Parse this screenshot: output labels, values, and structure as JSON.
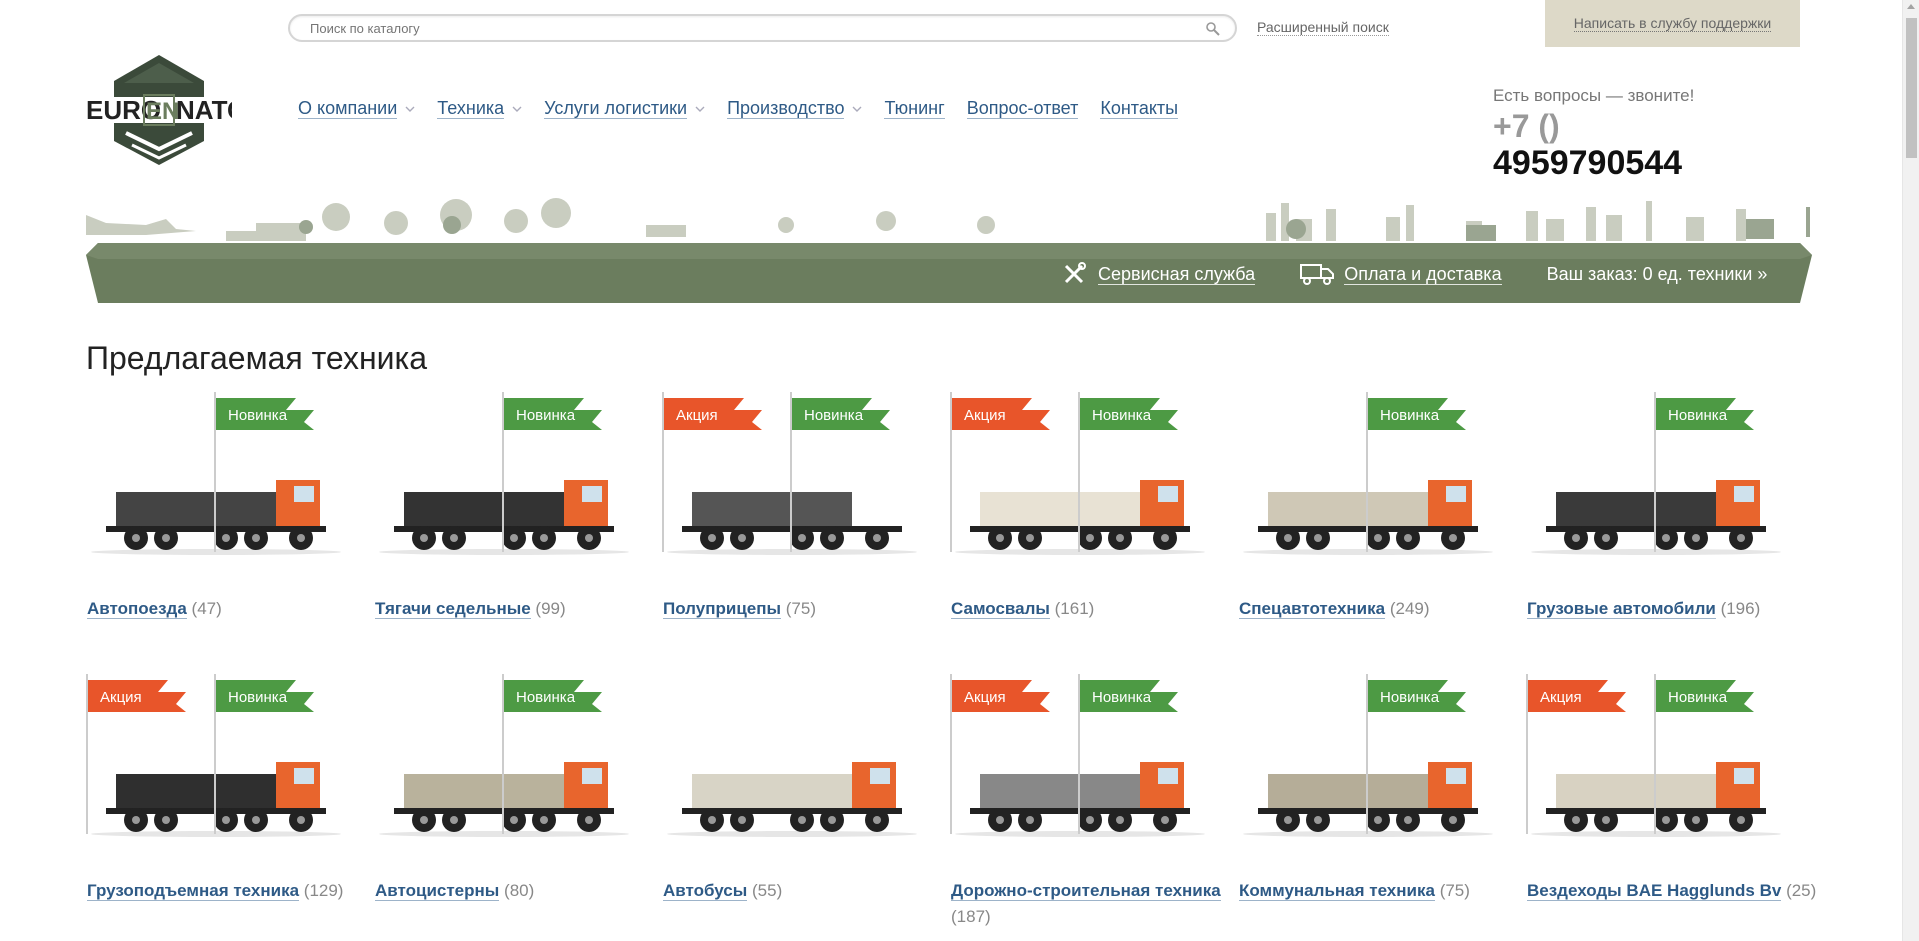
{
  "search": {
    "placeholder": "Поиск по каталогу",
    "advanced_label": "Расширенный поиск"
  },
  "support_link": "Написать в службу поддержки",
  "logo": {
    "text_left": "EURO",
    "text_mid": "EN",
    "text_right": "NATO"
  },
  "nav": [
    {
      "label": "О компании",
      "dropdown": true
    },
    {
      "label": "Техника",
      "dropdown": true
    },
    {
      "label": "Услуги логистики",
      "dropdown": true
    },
    {
      "label": "Производство",
      "dropdown": true
    },
    {
      "label": "Тюнинг",
      "dropdown": false
    },
    {
      "label": "Вопрос-ответ",
      "dropdown": false
    },
    {
      "label": "Контакты",
      "dropdown": false
    }
  ],
  "contact": {
    "caption": "Есть вопросы — звоните!",
    "prefix": "+7 ()",
    "number": "4959790544"
  },
  "banner": {
    "service_label": "Сервисная служба",
    "delivery_label": "Оплата и доставка",
    "order_label": "Ваш заказ: 0 ед. техники »"
  },
  "page_title": "Предлагаемая техника",
  "flags": {
    "sale": "Акция",
    "new": "Новинка"
  },
  "colors": {
    "link": "#2e5a86",
    "banner": "#6b7d5e",
    "sale_flag": "#e8552a",
    "new_flag": "#4d9a44",
    "truck_cab": "#e8652d"
  },
  "categories": [
    {
      "name": "Автопоезда",
      "count": "(47)",
      "sale": false,
      "new": true
    },
    {
      "name": "Тягачи седельные",
      "count": "(99)",
      "sale": false,
      "new": true
    },
    {
      "name": "Полуприцепы",
      "count": "(75)",
      "sale": true,
      "new": true
    },
    {
      "name": "Самосвалы",
      "count": "(161)",
      "sale": true,
      "new": true
    },
    {
      "name": "Спецавтотехника",
      "count": "(249)",
      "sale": false,
      "new": true
    },
    {
      "name": "Грузовые автомобили",
      "count": "(196)",
      "sale": false,
      "new": true
    },
    {
      "name": "Грузоподъемная техника",
      "count": "(129)",
      "sale": true,
      "new": true
    },
    {
      "name": "Автоцистерны",
      "count": "(80)",
      "sale": false,
      "new": true
    },
    {
      "name": "Автобусы",
      "count": "(55)",
      "sale": false,
      "new": false
    },
    {
      "name": "Дорожно-строительная техника",
      "count": "(187)",
      "sale": true,
      "new": true
    },
    {
      "name": "Коммунальная техника",
      "count": "(75)",
      "sale": false,
      "new": true
    },
    {
      "name": "Вездеходы BAE Hagglunds Bv",
      "count": "(25)",
      "sale": true,
      "new": true
    }
  ]
}
